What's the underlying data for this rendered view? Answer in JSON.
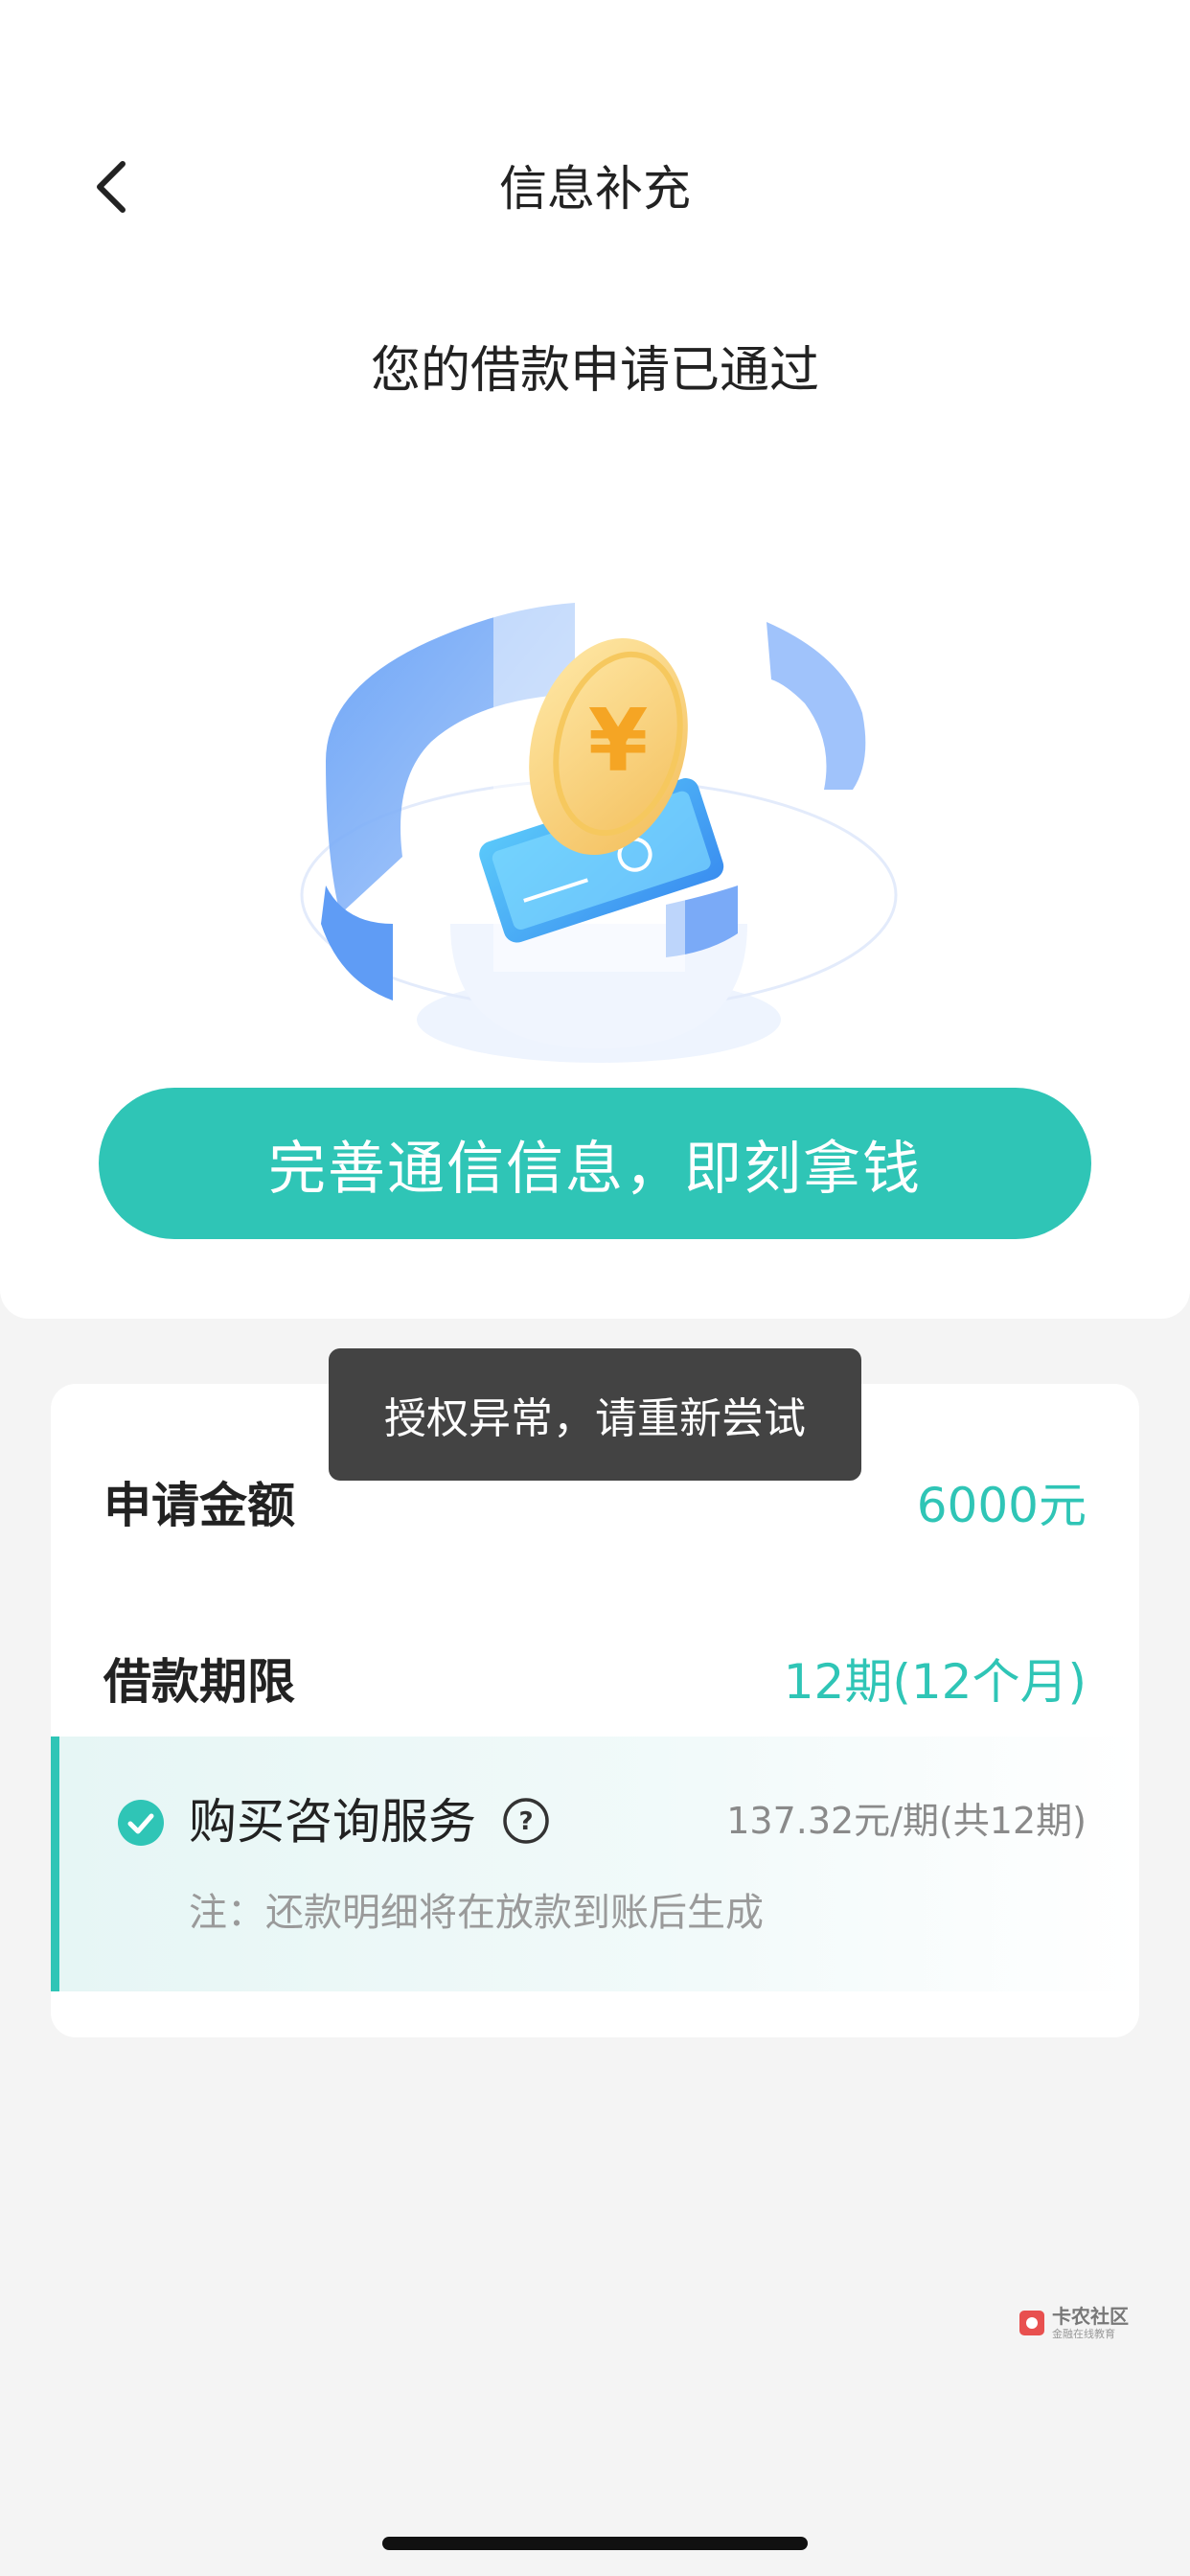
{
  "header": {
    "title": "信息补充"
  },
  "result": {
    "title": "您的借款申请已通过",
    "cta_label": "完善通信信息，即刻拿钱"
  },
  "details": {
    "amount_label": "申请金额",
    "amount_value": "6000元",
    "term_label": "借款期限",
    "term_value": "12期(12个月)",
    "service_label": "购买咨询服务",
    "service_price": "137.32元/期(共12期)",
    "service_note": "注：还款明细将在放款到账后生成"
  },
  "toast": {
    "message": "授权异常，请重新尝试"
  },
  "watermark": {
    "line1": "卡农社区",
    "line2": "金融在线教育"
  },
  "colors": {
    "accent": "#2fc5b6",
    "toast_bg": "#333333",
    "page_bg": "#f4f4f4"
  },
  "icons": {
    "back": "chevron-left-icon",
    "check": "check-circle-icon",
    "help": "question-circle-icon"
  }
}
